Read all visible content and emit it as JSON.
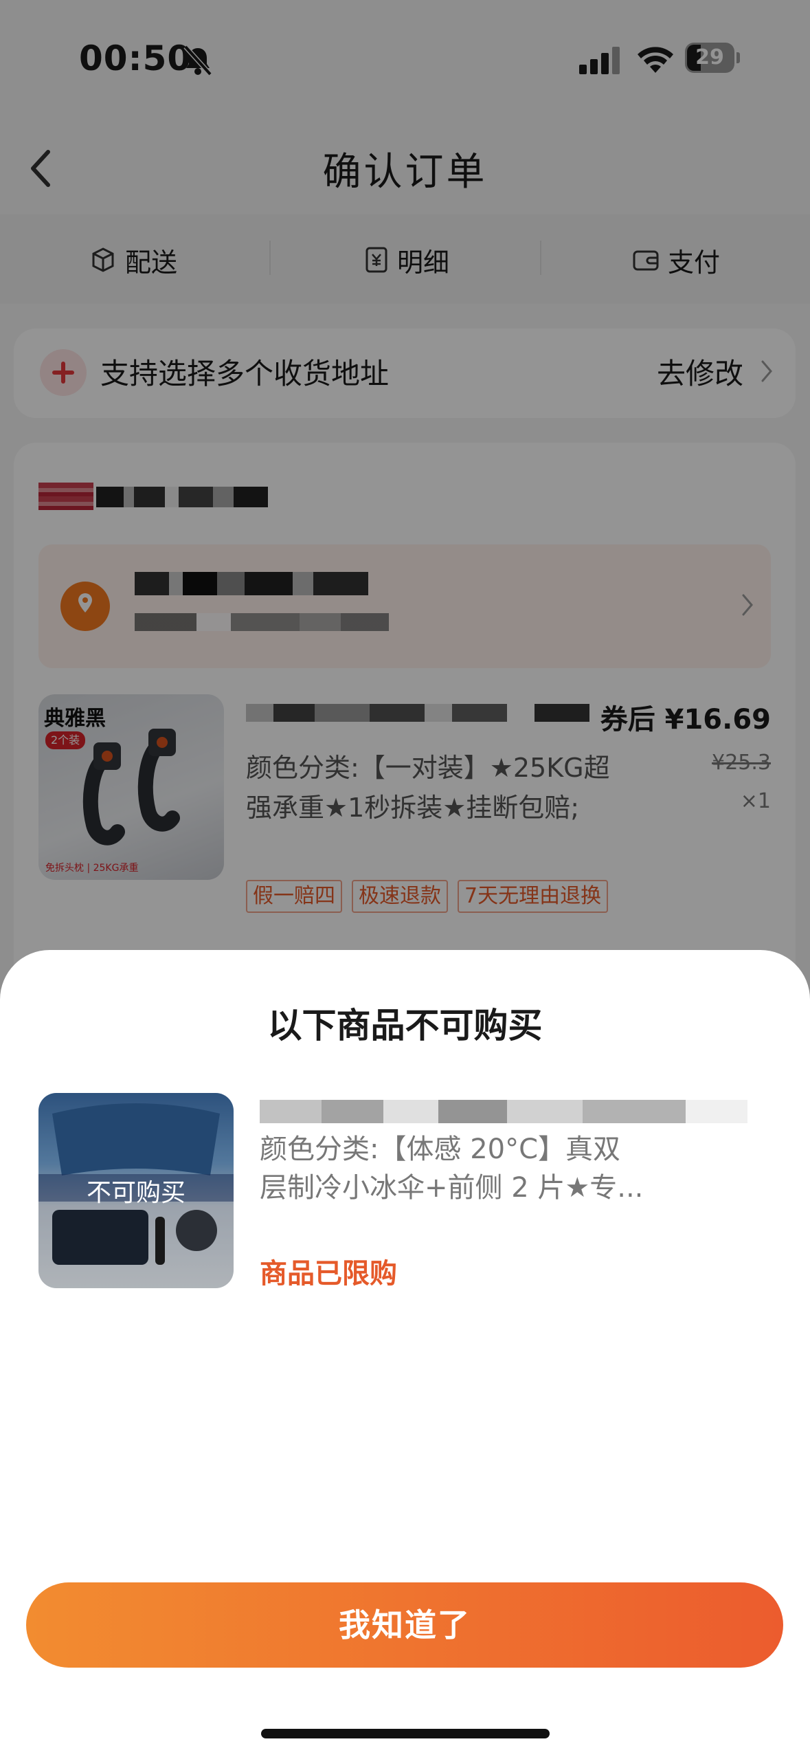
{
  "status": {
    "time": "00:50",
    "battery": "29"
  },
  "nav": {
    "title": "确认订单"
  },
  "steps": [
    {
      "label": "配送",
      "icon": "box-icon"
    },
    {
      "label": "明细",
      "icon": "receipt-icon"
    },
    {
      "label": "支付",
      "icon": "wallet-icon"
    }
  ],
  "address_banner": {
    "text": "支持选择多个收货地址",
    "action": "去修改"
  },
  "order_item": {
    "thumb_title": "典雅黑",
    "thumb_badge": "2个装",
    "thumb_footer": "免拆头枕 | 25KG承重",
    "price_after": "券后 ¥16.69",
    "spec": "颜色分类:【一对装】★25KG超强承重★1秒拆装★挂断包赔;",
    "old_price": "¥25.3",
    "qty": "×1",
    "tags": [
      "假一赔四",
      "极速退款",
      "7天无理由退换"
    ]
  },
  "sheet": {
    "title": "以下商品不可购买",
    "item_overlay": "不可购买",
    "item_spec": "颜色分类:【体感 20°C】真双层制冷小冰伞+前侧 2 片★专...",
    "item_status": "商品已限购",
    "confirm_button": "我知道了"
  },
  "colors": {
    "accent": "#ec5c2e",
    "accent_start": "#f28c30",
    "tag_text": "#e55a2a"
  }
}
